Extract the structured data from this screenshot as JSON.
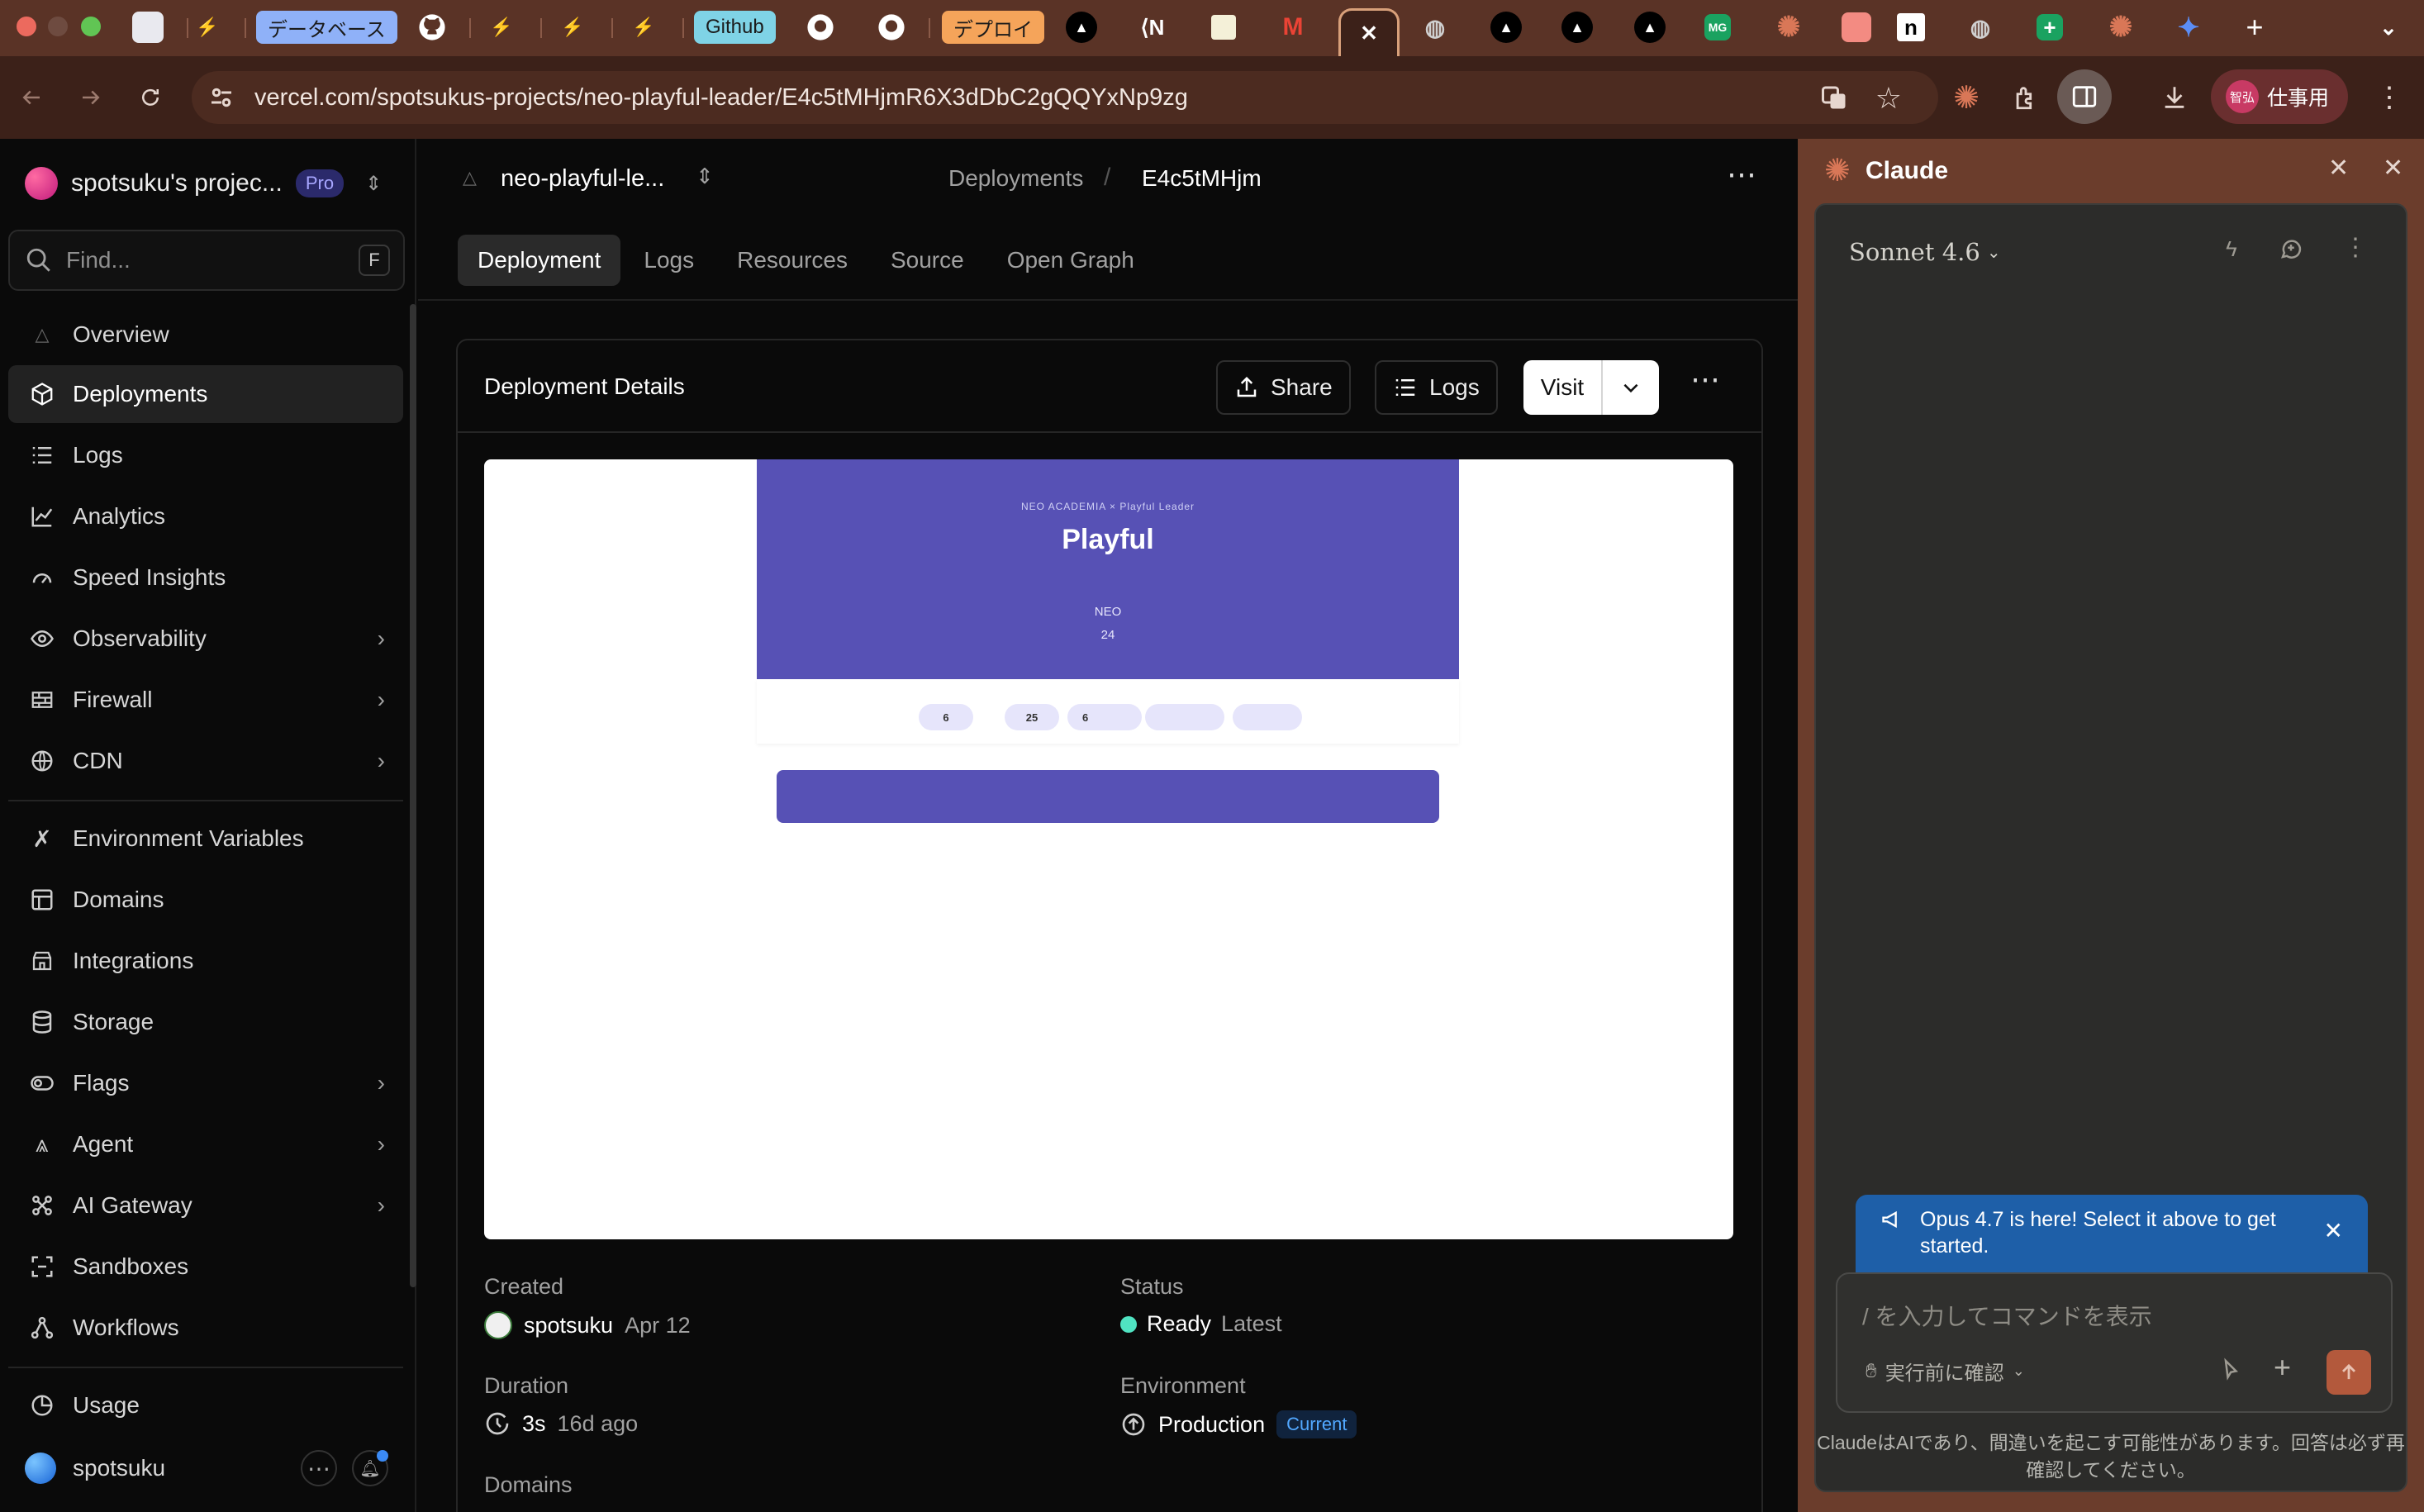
{
  "browser": {
    "tabs": {
      "group1": "データベース",
      "group2": "Github",
      "group3": "デプロイ",
      "badge_mg": "MG",
      "badge_n": "n"
    },
    "url": "vercel.com/spotsukus-projects/neo-playful-leader/E4c5tMHjmR6X3dDbC2gQQYxNp9zg",
    "profile": {
      "avatar_text": "智弘",
      "label": "仕事用"
    },
    "colors": {
      "accent": "#d8a07a",
      "frame": "#3c2119"
    }
  },
  "sidebar": {
    "team_name": "spotsuku's projec...",
    "plan_badge": "Pro",
    "search_placeholder": "Find...",
    "search_shortcut": "F",
    "items": [
      {
        "label": "Overview",
        "icon": "triangle-icon"
      },
      {
        "label": "Deployments",
        "icon": "cube-icon",
        "selected": true
      },
      {
        "label": "Logs",
        "icon": "list-icon"
      },
      {
        "label": "Analytics",
        "icon": "chart-icon"
      },
      {
        "label": "Speed Insights",
        "icon": "gauge-icon"
      },
      {
        "label": "Observability",
        "icon": "eye-icon",
        "expandable": true
      },
      {
        "label": "Firewall",
        "icon": "firewall-icon",
        "expandable": true
      },
      {
        "label": "CDN",
        "icon": "globe-icon",
        "expandable": true
      },
      {
        "label": "Environment Variables",
        "icon": "variable-icon"
      },
      {
        "label": "Domains",
        "icon": "domain-icon"
      },
      {
        "label": "Integrations",
        "icon": "store-icon"
      },
      {
        "label": "Storage",
        "icon": "database-icon"
      },
      {
        "label": "Flags",
        "icon": "toggle-icon",
        "expandable": true
      },
      {
        "label": "Agent",
        "icon": "agent-icon",
        "expandable": true
      },
      {
        "label": "AI Gateway",
        "icon": "gateway-icon",
        "expandable": true
      },
      {
        "label": "Sandboxes",
        "icon": "sandbox-icon"
      },
      {
        "label": "Workflows",
        "icon": "workflow-icon"
      }
    ],
    "usage_label": "Usage",
    "user_name": "spotsuku"
  },
  "header": {
    "project": "neo-playful-le...",
    "breadcrumb_parent": "Deployments",
    "breadcrumb_current": "E4c5tMHjm",
    "tabs": [
      "Deployment",
      "Logs",
      "Resources",
      "Source",
      "Open Graph"
    ]
  },
  "card": {
    "title": "Deployment Details",
    "share_label": "Share",
    "logs_label": "Logs",
    "visit_label": "Visit"
  },
  "preview": {
    "kicker": "NEO ACADEMIA × Playful Leader",
    "title": "Playful",
    "line1": "NEO",
    "line2": "24",
    "chips": [
      "6",
      "25",
      "6",
      "",
      ""
    ],
    "colors": {
      "hero": "#5751b5",
      "chip": "#e6e5fb"
    }
  },
  "details": {
    "created_label": "Created",
    "created_user": "spotsuku",
    "created_date": "Apr 12",
    "status_label": "Status",
    "status_value": "Ready",
    "status_extra": "Latest",
    "duration_label": "Duration",
    "duration_value": "3s",
    "duration_ago": "16d ago",
    "environment_label": "Environment",
    "environment_value": "Production",
    "environment_badge": "Current",
    "domains_label": "Domains"
  },
  "claude": {
    "title": "Claude",
    "model": "Sonnet 4.6",
    "notice": "Opus 4.7 is here! Select it above to get started.",
    "input_placeholder": "/ を入力してコマンドを表示",
    "permission_label": "実行前に確認",
    "disclaimer": "ClaudeはAIであり、間違いを起こす可能性があります。回答は必ず再確認してください。"
  }
}
